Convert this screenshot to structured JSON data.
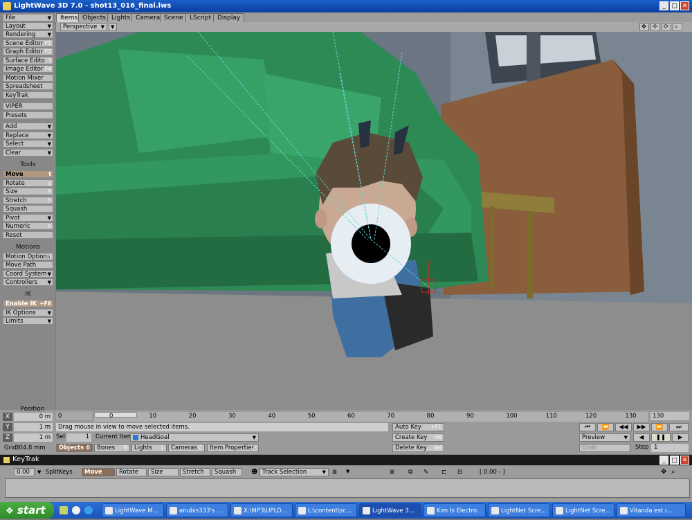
{
  "window": {
    "title": "LightWave 3D 7.0 - shot13_016_final.lws"
  },
  "tabs": [
    "Items",
    "Objects",
    "Lights",
    "Camera",
    "Scene",
    "LScript",
    "Display"
  ],
  "left_panel": {
    "menu": [
      {
        "label": "File",
        "arrow": true,
        "key": ""
      },
      {
        "label": "Layout",
        "arrow": true,
        "key": ""
      },
      {
        "label": "Rendering",
        "arrow": true,
        "key": ""
      },
      {
        "label": "Scene Editor",
        "arrow": false,
        "key": "F1"
      },
      {
        "label": "Graph Editor",
        "arrow": false,
        "key": "F2"
      },
      {
        "label": "Surface Editor",
        "arrow": false,
        "key": "F3"
      },
      {
        "label": "Image Editor",
        "arrow": false,
        "key": "F4"
      },
      {
        "label": "Motion Mixer",
        "arrow": false,
        "key": ""
      },
      {
        "label": "Spreadsheet",
        "arrow": false,
        "key": ""
      },
      {
        "label": "KeyTrak",
        "arrow": false,
        "key": ""
      }
    ],
    "menu2": [
      "VIPER",
      "Presets"
    ],
    "menu3": [
      {
        "label": "Add",
        "arrow": true
      },
      {
        "label": "Replace",
        "arrow": true
      },
      {
        "label": "Select",
        "arrow": true
      },
      {
        "label": "Clear",
        "arrow": true
      }
    ],
    "tools_heading": "Tools",
    "tools": [
      {
        "label": "Move",
        "key": "t",
        "arrow": false
      },
      {
        "label": "Rotate",
        "key": "y",
        "arrow": false
      },
      {
        "label": "Size",
        "key": "H",
        "arrow": false
      },
      {
        "label": "Stretch",
        "key": "h",
        "arrow": false
      },
      {
        "label": "Squash",
        "key": "",
        "arrow": false
      },
      {
        "label": "Pivot",
        "key": "",
        "arrow": true
      },
      {
        "label": "Numeric",
        "key": "n",
        "arrow": false
      },
      {
        "label": "Reset",
        "key": "",
        "arrow": false
      }
    ],
    "motions_heading": "Motions",
    "motions": [
      {
        "label": "Motion Options",
        "key": "m",
        "arrow": false
      },
      {
        "label": "Move Path",
        "key": "",
        "arrow": false
      },
      {
        "label": "Coord System",
        "key": "",
        "arrow": true
      },
      {
        "label": "Controllers",
        "key": "",
        "arrow": true
      }
    ],
    "ik_heading": "IK",
    "ik": [
      {
        "label": "Enable IK",
        "key": "+F8",
        "arrow": false
      },
      {
        "label": "IK Options",
        "key": "",
        "arrow": true
      },
      {
        "label": "Limits",
        "key": "",
        "arrow": true
      }
    ]
  },
  "viewport": {
    "view_mode": "Perspective"
  },
  "position": {
    "heading": "Position",
    "x": {
      "label": "X",
      "value": "0 m"
    },
    "y": {
      "label": "Y",
      "value": "1 m"
    },
    "z": {
      "label": "Z",
      "value": "1 m"
    },
    "grid_label": "Grid:",
    "grid_value": "304.8 mm"
  },
  "timeline": {
    "start": "0",
    "current": "0",
    "end": "130",
    "ticks": [
      "0",
      "10",
      "20",
      "30",
      "40",
      "50",
      "60",
      "70",
      "80",
      "90",
      "100",
      "110",
      "120",
      "130"
    ]
  },
  "status": {
    "message": "Drag mouse in view to move selected items."
  },
  "selection": {
    "sel_label": "Sel:",
    "sel_value": "1",
    "current_item_label": "Current Item",
    "current_item": "HeadGoal"
  },
  "item_types": [
    {
      "label": "Objects",
      "key": "0"
    },
    {
      "label": "Bones",
      "key": "B"
    },
    {
      "label": "Lights",
      "key": "L"
    },
    {
      "label": "Cameras",
      "key": "C"
    },
    {
      "label": "Item Properties",
      "key": "p"
    }
  ],
  "keys": {
    "auto_key": "Auto Key",
    "auto_key_hotkey": "+F1",
    "create_key": "Create Key",
    "create_key_hotkey": "ret",
    "delete_key": "Delete Key",
    "delete_key_hotkey": "del"
  },
  "playback": {
    "preview": "Preview",
    "undo": "Undo",
    "step_label": "Step",
    "step_value": "1"
  },
  "keytrak": {
    "title": "KeyTrak",
    "value": "0.00",
    "split_keys": "SplitKeys",
    "modes": [
      "Move",
      "Rotate",
      "Size",
      "Stretch",
      "Squash"
    ],
    "track_selection": "Track Selection",
    "range": "[ 0.00 - ]"
  },
  "taskbar": {
    "start": "start",
    "tasks": [
      {
        "label": "LightWave M..."
      },
      {
        "label": "anubis333's ..."
      },
      {
        "label": "X:\\MP3\\UPLO..."
      },
      {
        "label": "L:\\content\\sc..."
      },
      {
        "label": "LightWave 3..."
      },
      {
        "label": "Kim Is Electro..."
      },
      {
        "label": "LightNet Scre..."
      },
      {
        "label": "LightNet Scre..."
      },
      {
        "label": "Vitanda est i..."
      }
    ]
  },
  "colors": {
    "title_bar": "#1a5fc8",
    "taskbar": "#2b6fd6",
    "start": "#3e9b36",
    "sofa": "#2d8a55"
  }
}
